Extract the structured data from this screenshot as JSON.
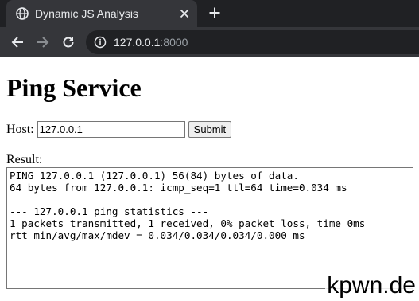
{
  "browser": {
    "tab_title": "Dynamic JS Analysis",
    "url_host": "127.0.0.1",
    "url_port": ":8000",
    "icons": {
      "tab_favicon": "globe-icon",
      "tab_close": "close-icon",
      "new_tab": "plus-icon",
      "back": "back-arrow-icon",
      "forward": "forward-arrow-icon",
      "reload": "reload-icon",
      "site_info": "info-icon"
    }
  },
  "page": {
    "heading": "Ping Service",
    "host_label": "Host:",
    "host_value": "127.0.0.1",
    "submit_label": "Submit",
    "result_label": "Result:",
    "result_text": "PING 127.0.0.1 (127.0.0.1) 56(84) bytes of data.\n64 bytes from 127.0.0.1: icmp_seq=1 ttl=64 time=0.034 ms\n\n--- 127.0.0.1 ping statistics ---\n1 packets transmitted, 1 received, 0% packet loss, time 0ms\nrtt min/avg/max/mdev = 0.034/0.034/0.034/0.000 ms"
  },
  "watermark": "kpwn.de",
  "colors": {
    "tabbar_bg": "#202124",
    "toolbar_bg": "#35363a",
    "text_light": "#e8eaed"
  }
}
